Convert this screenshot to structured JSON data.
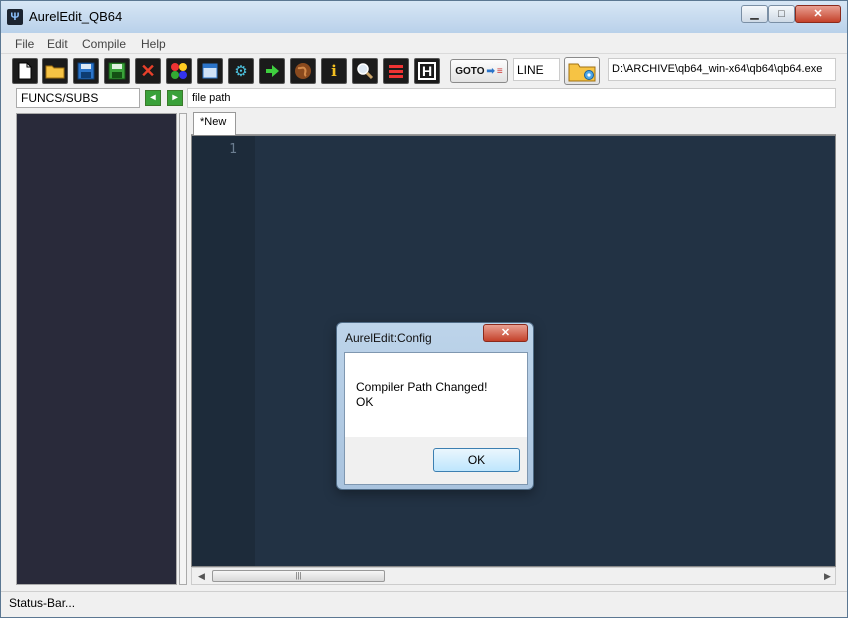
{
  "window": {
    "title": "AurelEdit_QB64",
    "icon": "qb64-app-icon"
  },
  "menu": [
    "File",
    "Edit",
    "Compile",
    "Help"
  ],
  "toolbar": {
    "icons": [
      "new-file-icon",
      "open-folder-icon",
      "save-icon",
      "save-as-icon",
      "close-file-icon",
      "color-icon",
      "window-icon",
      "settings-gear-icon",
      "run-icon",
      "globe-icon",
      "info-icon",
      "search-icon",
      "list-icon",
      "help-icon"
    ],
    "goto_label": "GOTO",
    "line_value": "LINE",
    "compiler_path": "D:\\ARCHIVE\\qb64_win-x64\\qb64\\qb64.exe"
  },
  "nav": {
    "funcs_value": "FUNCS/SUBS",
    "file_path_label": "file path"
  },
  "tabs": [
    {
      "label": "*New"
    }
  ],
  "editor": {
    "line_numbers": [
      "1"
    ]
  },
  "statusbar": {
    "text": "Status-Bar..."
  },
  "dialog": {
    "title": "AurelEdit:Config",
    "message_line1": "Compiler Path Changed!",
    "message_line2": "OK",
    "ok_label": "OK"
  },
  "colors": {
    "editor_bg": "#223244",
    "sidebar_bg": "#292a3a",
    "accent": "#3c7fb1"
  }
}
